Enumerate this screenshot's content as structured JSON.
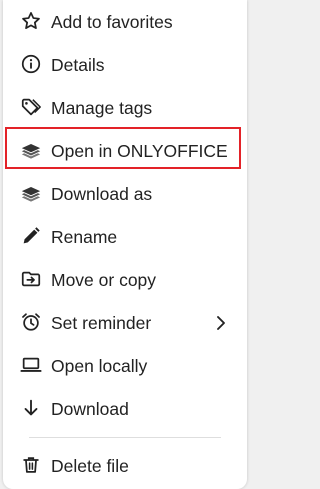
{
  "menu": {
    "items": [
      {
        "label": "Add to favorites",
        "icon": "star-icon"
      },
      {
        "label": "Details",
        "icon": "info-icon"
      },
      {
        "label": "Manage tags",
        "icon": "tag-icon"
      },
      {
        "label": "Open in ONLYOFFICE",
        "icon": "onlyoffice-icon"
      },
      {
        "label": "Download as",
        "icon": "onlyoffice-icon"
      },
      {
        "label": "Rename",
        "icon": "pencil-icon"
      },
      {
        "label": "Move or copy",
        "icon": "folder-move-icon"
      },
      {
        "label": "Set reminder",
        "icon": "alarm-icon"
      },
      {
        "label": "Open locally",
        "icon": "laptop-icon"
      },
      {
        "label": "Download",
        "icon": "arrow-down-icon"
      },
      {
        "label": "Delete file",
        "icon": "trash-icon"
      }
    ]
  },
  "colors": {
    "highlight_border": "#e32228",
    "icon": "#222222",
    "divider": "#dedede"
  }
}
